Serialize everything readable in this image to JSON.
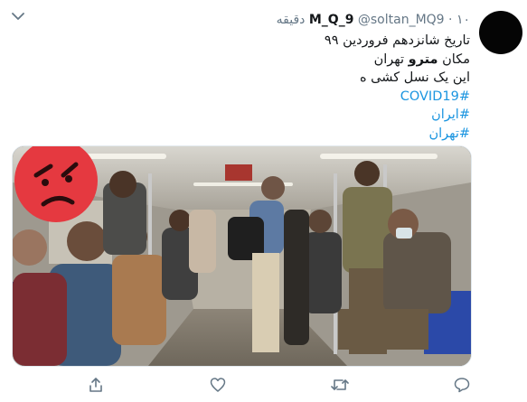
{
  "tweet": {
    "display_name": "M_Q_9",
    "handle": "@soltan_MQ9",
    "separator": "·",
    "time": "۱۰ دقیقه",
    "lines": {
      "line1": "تاریخ شانزدهم فروردین ۹۹",
      "line2_prefix": "مکان",
      "line2_bold": "مترو",
      "line2_suffix": "تهران",
      "line3": "این یک نسل کشی ه"
    },
    "hashtags": [
      "#COVID19",
      "#ایران",
      "#تهران"
    ]
  },
  "icons": {
    "menu": "chevron-down-icon",
    "reply": "reply-icon",
    "retweet": "retweet-icon",
    "like": "heart-icon",
    "share": "share-icon"
  },
  "colors": {
    "link": "#1b95e0",
    "muted": "#657786",
    "text": "#14171a",
    "emoji_red": "#e53940"
  }
}
